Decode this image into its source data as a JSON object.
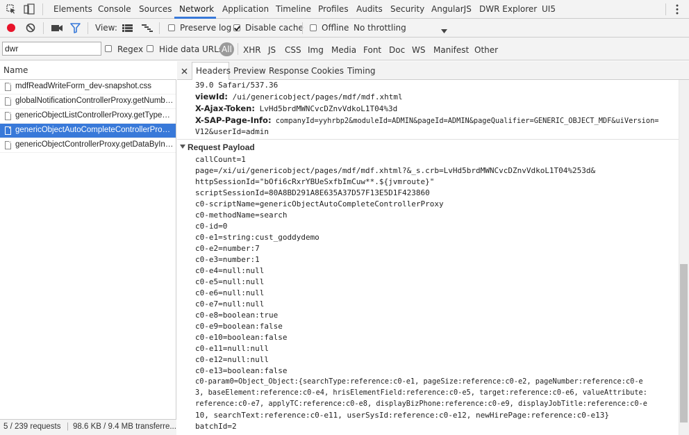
{
  "main_tabs": [
    "Elements",
    "Console",
    "Sources",
    "Network",
    "Application",
    "Timeline",
    "Profiles",
    "Audits",
    "Security",
    "AngularJS",
    "DWR Explorer",
    "UI5"
  ],
  "active_tab": "Network",
  "toolbar": {
    "view_label": "View:",
    "preserve_log": "Preserve log",
    "disable_cache": "Disable cache",
    "offline": "Offline",
    "throttling": "No throttling"
  },
  "filter": {
    "value": "dwr",
    "regex": "Regex",
    "hide_data_urls": "Hide data URLs",
    "types": [
      "All",
      "XHR",
      "JS",
      "CSS",
      "Img",
      "Media",
      "Font",
      "Doc",
      "WS",
      "Manifest",
      "Other"
    ]
  },
  "requests": {
    "column_header": "Name",
    "items": [
      "mdfReadWriteForm_dev-snapshot.css",
      "globalNotificationControllerProxy.getNumbe...",
      "genericObjectListControllerProxy.getTypes.dwr",
      "genericObjectAutoCompleteControllerProxy....",
      "genericObjectControllerProxy.getDataByInter..."
    ],
    "selected_index": 3
  },
  "status": {
    "requests": "5 / 239 requests",
    "transferred": "98.6 KB / 9.4 MB transferre..."
  },
  "detail_tabs": [
    "Headers",
    "Preview",
    "Response",
    "Cookies",
    "Timing"
  ],
  "headers": {
    "ua_tail": "39.0 Safari/537.36",
    "lines": [
      {
        "key": "viewId:",
        "value": " /ui/genericobject/pages/mdf/mdf.xhtml"
      },
      {
        "key": "X-Ajax-Token:",
        "value": " LvHd5brdMWNCvcDZnvVdkoL1T04%3d"
      },
      {
        "key": "X-SAP-Page-Info:",
        "value": " companyId=yyhrbp2&moduleId=ADMIN&pageId=ADMIN&pageQualifier=GENERIC_OBJECT_MDF&uiVersion="
      }
    ],
    "wrap": "V12&userId=admin"
  },
  "payload": {
    "title": "Request Payload",
    "lines": [
      "callCount=1",
      "page=/xi/ui/genericobject/pages/mdf/mdf.xhtml?&_s.crb=LvHd5brdMWNCvcDZnvVdkoL1T04%253d&",
      "httpSessionId=\"bOfi6cRxrYBUeSxfbImCuw**.${jvmroute}\"",
      "scriptSessionId=80A8BD291A8E635A37D57F13E5D1F423860",
      "c0-scriptName=genericObjectAutoCompleteControllerProxy",
      "c0-methodName=search",
      "c0-id=0",
      "c0-e1=string:cust_goddydemo",
      "c0-e2=number:7",
      "c0-e3=number:1",
      "c0-e4=null:null",
      "c0-e5=null:null",
      "c0-e6=null:null",
      "c0-e7=null:null",
      "c0-e8=boolean:true",
      "c0-e9=boolean:false",
      "c0-e10=boolean:false",
      "c0-e11=null:null",
      "c0-e12=null:null",
      "c0-e13=boolean:false",
      "c0-param0=Object_Object:{searchType:reference:c0-e1, pageSize:reference:c0-e2, pageNumber:reference:c0-e",
      "3, baseElement:reference:c0-e4, hrisElementField:reference:c0-e5, target:reference:c0-e6, valueAttribute:",
      "reference:c0-e7, applyTC:reference:c0-e8, displayBizPhone:reference:c0-e9, displayJobTitle:reference:c0-e",
      "10, searchText:reference:c0-e11, userSysId:reference:c0-e12, newHirePage:reference:c0-e13}",
      "batchId=2"
    ]
  },
  "colors": {
    "accent": "#3879d9",
    "record": "#e8132a",
    "filter_icon": "#3879d9"
  }
}
